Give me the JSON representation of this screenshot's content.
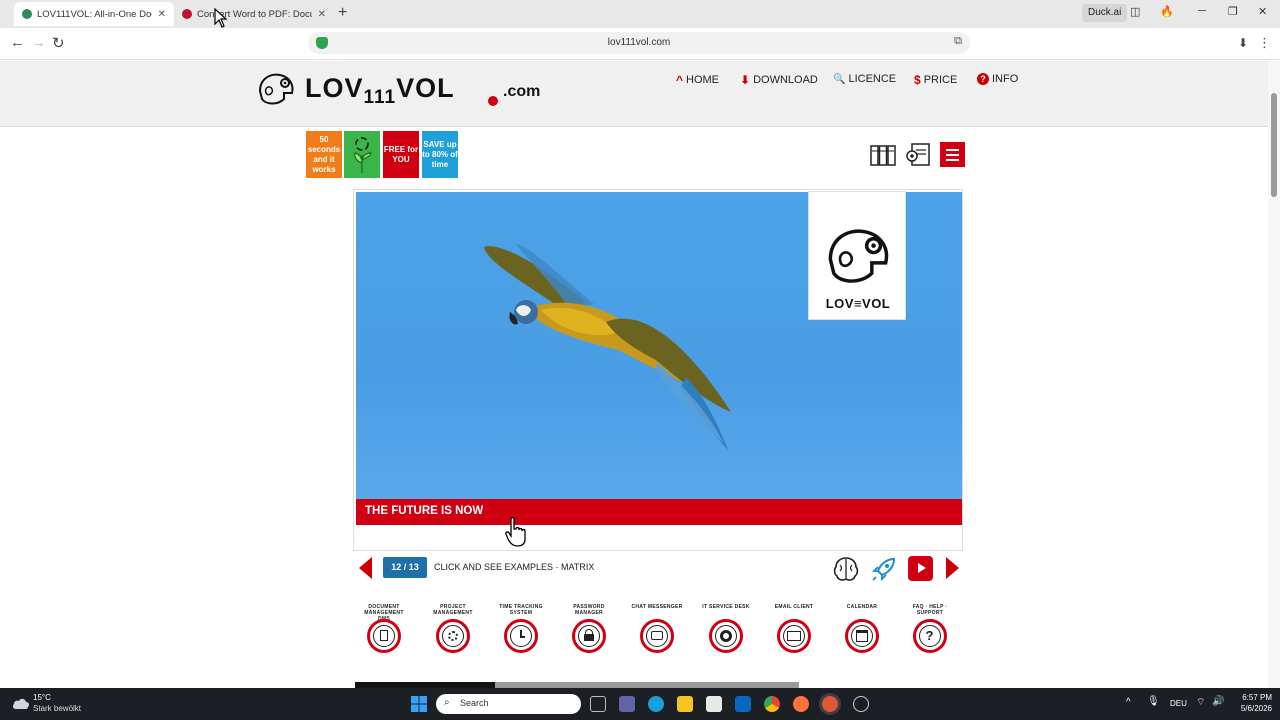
{
  "browser": {
    "tabs": [
      {
        "title": "LOV111VOL: All-in-One Docum",
        "active": true,
        "favicon_color": "#2e8b57"
      },
      {
        "title": "Convert Word to PDF: Docume",
        "active": false,
        "favicon_color": "#c0122b"
      }
    ],
    "duck_ai_label": "Duck.ai",
    "url": "lov111vol.com"
  },
  "site": {
    "brand_main": "LOV",
    "brand_num": "111",
    "brand_end": "VOL",
    "brand_tld": ".com",
    "nav": [
      {
        "label": "HOME",
        "icon": "^"
      },
      {
        "label": "DOWNLOAD",
        "icon": "⬇"
      },
      {
        "label": "LICENCE",
        "icon": "🔍"
      },
      {
        "label": "PRICE",
        "icon": "$"
      },
      {
        "label": "INFO",
        "icon": "?"
      }
    ],
    "badges": [
      {
        "text": "50 seconds and it works",
        "color": "#f07d1a"
      },
      {
        "text": "",
        "color": "#3ab54a",
        "icon": "recycle-plant-icon"
      },
      {
        "text": "FREE for YOU",
        "color": "#d00012"
      },
      {
        "text": "SAVE up to 80% of time",
        "color": "#1fa0d8"
      }
    ]
  },
  "slide": {
    "logo_text": "LOV≡VOL",
    "caption": "THE FUTURE IS NOW",
    "counter": "12 / 13",
    "examples_text": "CLICK AND SEE EXAMPLES · MATRIX"
  },
  "modules": [
    {
      "caption": "DOCUMENT MANAGEMENT DMS",
      "icon": "document-icon"
    },
    {
      "caption": "PROJECT MANAGEMENT",
      "icon": "gears-icon"
    },
    {
      "caption": "TIME TRACKING SYSTEM",
      "icon": "clock-icon"
    },
    {
      "caption": "PASSWORD MANAGER",
      "icon": "lock-icon"
    },
    {
      "caption": "CHAT MESSENGER",
      "icon": "chat-icon"
    },
    {
      "caption": "IT SERVICE DESK",
      "icon": "lifebuoy-icon"
    },
    {
      "caption": "EMAIL CLIENT",
      "icon": "envelope-icon"
    },
    {
      "caption": "CALENDAR",
      "icon": "calendar-icon"
    },
    {
      "caption": "FAQ · HELP · SUPPORT",
      "icon": "question-icon"
    }
  ],
  "taskbar": {
    "weather_temp": "15°C",
    "weather_desc": "Stark bewölkt",
    "search_label": "Search",
    "lang": "DEU",
    "time": "6:57 PM",
    "date": "5/6/2026"
  },
  "colors": {
    "accent_red": "#d00012",
    "counter_blue": "#1f6fa8",
    "sky_blue": "#4a9de4"
  }
}
